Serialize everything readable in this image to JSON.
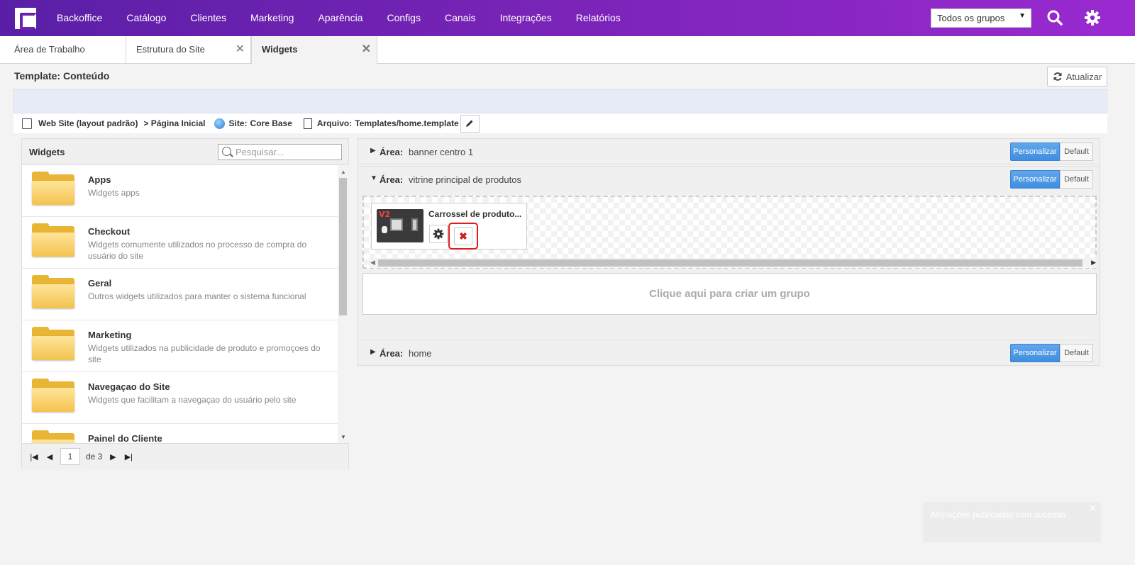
{
  "nav": {
    "items": [
      "Backoffice",
      "Catálogo",
      "Clientes",
      "Marketing",
      "Aparência",
      "Configs",
      "Canais",
      "Integrações",
      "Relatórios"
    ],
    "group_select": "Todos os grupos"
  },
  "tabs": [
    {
      "label": "Área de Trabalho"
    },
    {
      "label": "Estrutura do Site"
    },
    {
      "label": "Widgets"
    }
  ],
  "page": {
    "title": "Template: Conteúdo",
    "refresh_label": "Atualizar"
  },
  "crumb": {
    "website": "Web Site (layout padrão)",
    "page": "> Página Inicial",
    "site_label": "Site:",
    "site_value": "Core Base",
    "file_label": "Arquivo:",
    "file_value": "Templates/home.template"
  },
  "widgets_panel": {
    "title": "Widgets",
    "search_placeholder": "Pesquisar...",
    "items": [
      {
        "name": "Apps",
        "desc": "Widgets apps"
      },
      {
        "name": "Checkout",
        "desc": "Widgets comumente utilizados no processo de compra do usuário do site"
      },
      {
        "name": "Geral",
        "desc": "Outros widgets utilizados para manter o sistema funcional"
      },
      {
        "name": "Marketing",
        "desc": "Widgets utilizados na publicidade de produto e promoçoes do site"
      },
      {
        "name": "Navegaçao do Site",
        "desc": "Widgets que facilitam a navegaçao do usuário pelo site"
      },
      {
        "name": "Painel do Cliente",
        "desc": ""
      }
    ],
    "pager": {
      "page": "1",
      "of": "de 3"
    }
  },
  "areas": {
    "label": "Área:",
    "personalize_label": "Personalizar",
    "default_label": "Default",
    "rows": [
      {
        "value": "banner centro 1",
        "expanded": false
      },
      {
        "value": "vitrine principal de produtos",
        "expanded": true
      },
      {
        "value": "home",
        "expanded": false
      }
    ],
    "widget": {
      "title": "Carrossel de produto...",
      "badge": "V2"
    },
    "create_group": "Clique aqui para criar um grupo"
  },
  "toast": {
    "message": "Alterações publicadas com sucesso"
  }
}
